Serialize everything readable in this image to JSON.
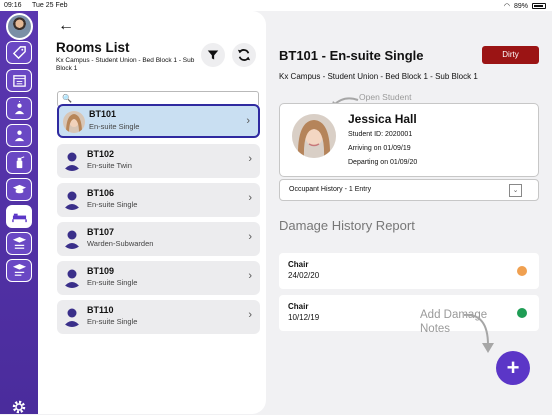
{
  "status": {
    "time": "09:16",
    "date": "Tue 25 Feb",
    "battery": "89%"
  },
  "sidebar": {
    "items": [
      {
        "icon": "tag-icon"
      },
      {
        "icon": "calendar-icon"
      },
      {
        "icon": "person-up-icon"
      },
      {
        "icon": "person-up-2-icon"
      },
      {
        "icon": "spray-icon"
      },
      {
        "icon": "graduation-cap-icon"
      },
      {
        "icon": "bed-icon",
        "active": true
      },
      {
        "icon": "graduation-list-icon"
      },
      {
        "icon": "graduation-list-2-icon"
      }
    ]
  },
  "rooms": {
    "title": "Rooms List",
    "subtitle": "Kx Campus - Student Union - Bed Block 1 - Sub Block 1",
    "search_icon": "🔍",
    "list": [
      {
        "name": "BT101",
        "type": "En-suite Single",
        "selected": true
      },
      {
        "name": "BT102",
        "type": "En-suite Twin"
      },
      {
        "name": "BT106",
        "type": "En-suite Single"
      },
      {
        "name": "BT107",
        "type": "Warden-Subwarden"
      },
      {
        "name": "BT109",
        "type": "En-suite Single"
      },
      {
        "name": "BT110",
        "type": "En-suite Single"
      }
    ]
  },
  "detail": {
    "title": "BT101 - En-suite Single",
    "status_badge": "Dirty",
    "location": "Kx Campus - Student Union - Bed Block 1 - Sub Block 1",
    "open_hint": "Open Student",
    "student": {
      "name": "Jessica Hall",
      "id_line": "Student ID: 2020001",
      "arriving": "Arriving on 01/09/19",
      "departing": "Departing on 01/09/20"
    },
    "history_label": "Occupant History - 1  Entry",
    "damage_title": "Damage History Report",
    "damage": [
      {
        "item": "Chair",
        "date": "24/02/20",
        "color": "#f0a050"
      },
      {
        "item": "Chair",
        "date": "10/12/19",
        "color": "#1f9d55"
      }
    ],
    "add_hint": "Add Damage Notes",
    "add_symbol": "+"
  },
  "colors": {
    "accent": "#5b36c7",
    "dirty": "#9b1414"
  }
}
